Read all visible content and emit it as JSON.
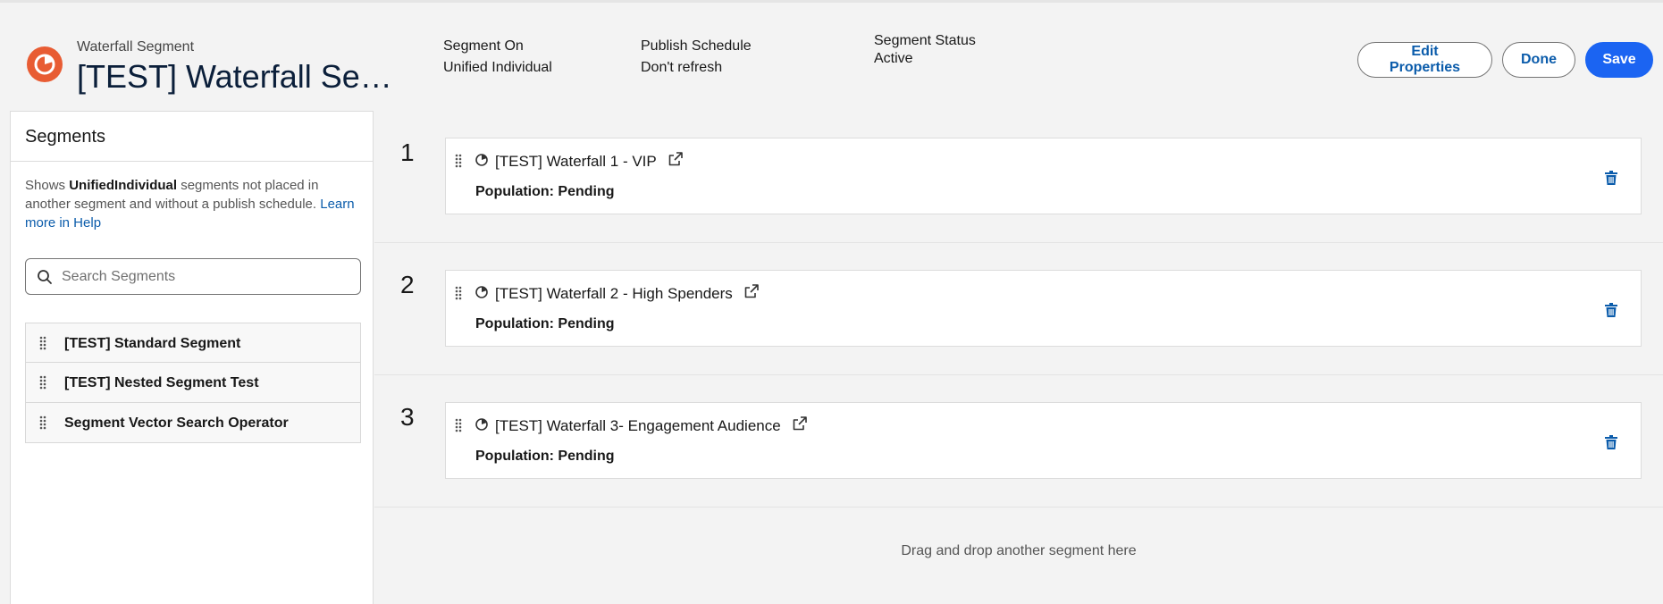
{
  "header": {
    "record_type": "Waterfall Segment",
    "title": "[TEST] Waterfall Segment",
    "fields": [
      {
        "label": "Segment On",
        "value": "Unified Individual"
      },
      {
        "label": "Publish Schedule",
        "value": "Don't refresh"
      },
      {
        "label": "Segment Status",
        "value": "Active"
      }
    ],
    "buttons": {
      "edit": "Edit Properties",
      "done": "Done",
      "save": "Save"
    }
  },
  "left_panel": {
    "title": "Segments",
    "help_prefix": "Shows ",
    "help_bold": "UnifiedIndividual",
    "help_middle": " segments not placed in another segment and without a publish schedule. ",
    "help_link": "Learn more in Help",
    "search_placeholder": "Search Segments",
    "items": [
      {
        "label": "[TEST] Standard Segment"
      },
      {
        "label": "[TEST] Nested Segment Test"
      },
      {
        "label": "Segment Vector Search Operator"
      }
    ]
  },
  "waterfall": [
    {
      "rank": "1",
      "name": "[TEST] Waterfall 1 - VIP",
      "population": "Population: Pending"
    },
    {
      "rank": "2",
      "name": "[TEST] Waterfall 2 - High Spenders",
      "population": "Population: Pending"
    },
    {
      "rank": "3",
      "name": "[TEST] Waterfall 3- Engagement Audience",
      "population": "Population: Pending"
    }
  ],
  "dropzone_text": "Drag and drop another segment here",
  "colors": {
    "brand": "#e85c33",
    "primary": "#1b64f2",
    "link": "#0b5cab"
  }
}
